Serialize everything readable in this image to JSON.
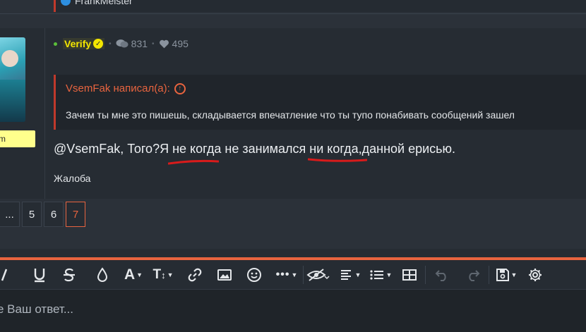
{
  "previous_post": {
    "author": "FrankMeister"
  },
  "post": {
    "username": "Verify",
    "messages_count": "831",
    "likes_count": "495",
    "user_badge": "m",
    "quote": {
      "author_label": "VsemFak написал(а):",
      "text": "Зачем ты мне это пишешь, складывается впечатление что ты тупо понабивать сообщений зашел"
    },
    "message": {
      "part1": "@VsemFak, Того?Я ",
      "underlined1": "не когда",
      "part2": " не занимался ",
      "underlined2": "ни когда,",
      "part3": "данной ерисью."
    },
    "report_link": "Жалоба"
  },
  "pagination": {
    "pages": [
      "...",
      "5",
      "6",
      "7"
    ],
    "current": "7"
  },
  "editor": {
    "placeholder": "е Ваш ответ...",
    "toolbar": [
      "underline-icon",
      "strikethrough-icon",
      "text-color-icon",
      "font-family-icon",
      "font-size-icon",
      "link-icon",
      "image-icon",
      "smilies-icon",
      "more-options-icon",
      "spoiler-icon",
      "align-icon",
      "list-icon",
      "table-icon",
      "undo-icon",
      "redo-icon",
      "drafts-icon",
      "settings-icon"
    ]
  },
  "colors": {
    "accent": "#e8643f",
    "username": "#f5e700",
    "quote_border": "#c0392b",
    "underline_marker": "#d81b1b"
  }
}
